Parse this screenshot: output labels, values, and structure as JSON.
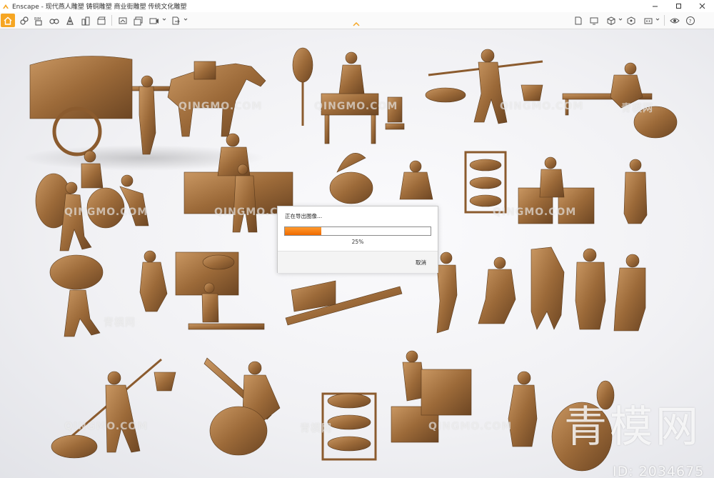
{
  "window": {
    "title": "Enscape - 现代燕人雕塑 铸铜雕塑 商业街雕塑 传统文化雕塑",
    "controls": [
      "minimize",
      "maximize",
      "close"
    ]
  },
  "toolbar": {
    "left_icons": [
      "home-icon",
      "link-icon",
      "bim-icon",
      "binoculars-icon",
      "asset-icon",
      "buildings-icon",
      "clapperboard-icon",
      "export-image-icon",
      "export-batch-icon",
      "export-video-icon",
      "export-file-icon"
    ],
    "right_icons": [
      "document-icon",
      "monitor-icon",
      "cube-icon",
      "settings-cube-icon",
      "palette-icon",
      "eye-icon",
      "help-icon"
    ],
    "accent_color": "#f6a623"
  },
  "viewport": {
    "watermarks": [
      "QINGMO.COM",
      "QINGMO.COM",
      "QINGMO.COM",
      "QINGMO.COM",
      "QINGMO.COM",
      "QINGMO.COM",
      "QINGMO.COM",
      "QINGMO.COM",
      "青模网",
      "青模网",
      "青模网"
    ],
    "brand": "青模网",
    "id_label": "ID: 2034675",
    "sculpture_color": "#a3713d"
  },
  "export_dialog": {
    "title": "正在导出图像...",
    "progress": 25,
    "progress_text": "25%",
    "cancel_label": "取消",
    "progress_color": "#f47c12"
  }
}
